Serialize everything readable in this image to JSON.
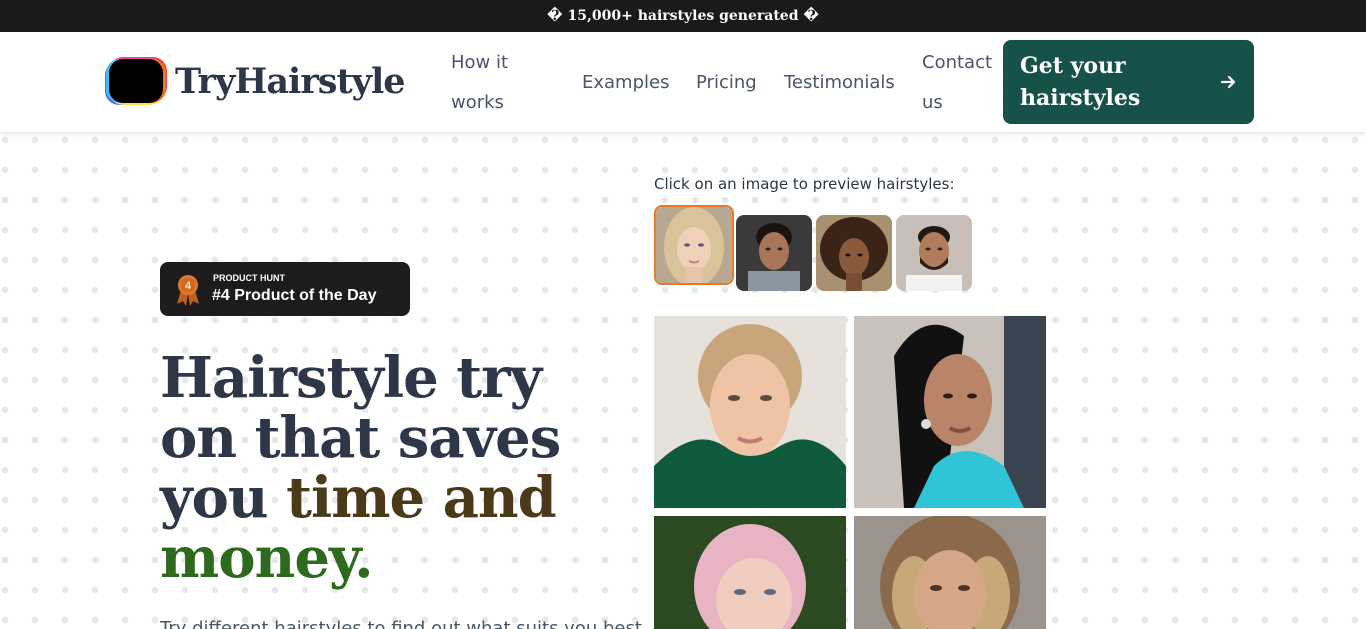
{
  "announcement": {
    "text": "� 15,000+ hairstyles generated �"
  },
  "logo": {
    "text": "TryHairstyle",
    "icon": "logo-gradient-icon"
  },
  "nav": {
    "how_it_works_line1": "How it",
    "how_it_works_line2": "works",
    "examples": "Examples",
    "pricing": "Pricing",
    "testimonials": "Testimonials",
    "contact_line1": "Contact",
    "contact_line2": "us"
  },
  "cta": {
    "line1": "Get your",
    "line2": "hairstyles",
    "icon": "arrow-right-icon"
  },
  "badge": {
    "small": "PRODUCT HUNT",
    "main": "#4 Product of the Day",
    "icon": "medal-icon",
    "rank": "4"
  },
  "hero": {
    "line1": "Hairstyle try",
    "line2": "on that saves",
    "line3_a": "you ",
    "line3_b": "time and",
    "line4": "money.",
    "subtext": "Try different hairstyles to find out what suits you best"
  },
  "preview": {
    "label": "Click on an image to preview hairstyles:"
  },
  "colors": {
    "accent": "#16524a",
    "selected_border": "#ea7a2a",
    "topbar": "#1a1a1a"
  }
}
